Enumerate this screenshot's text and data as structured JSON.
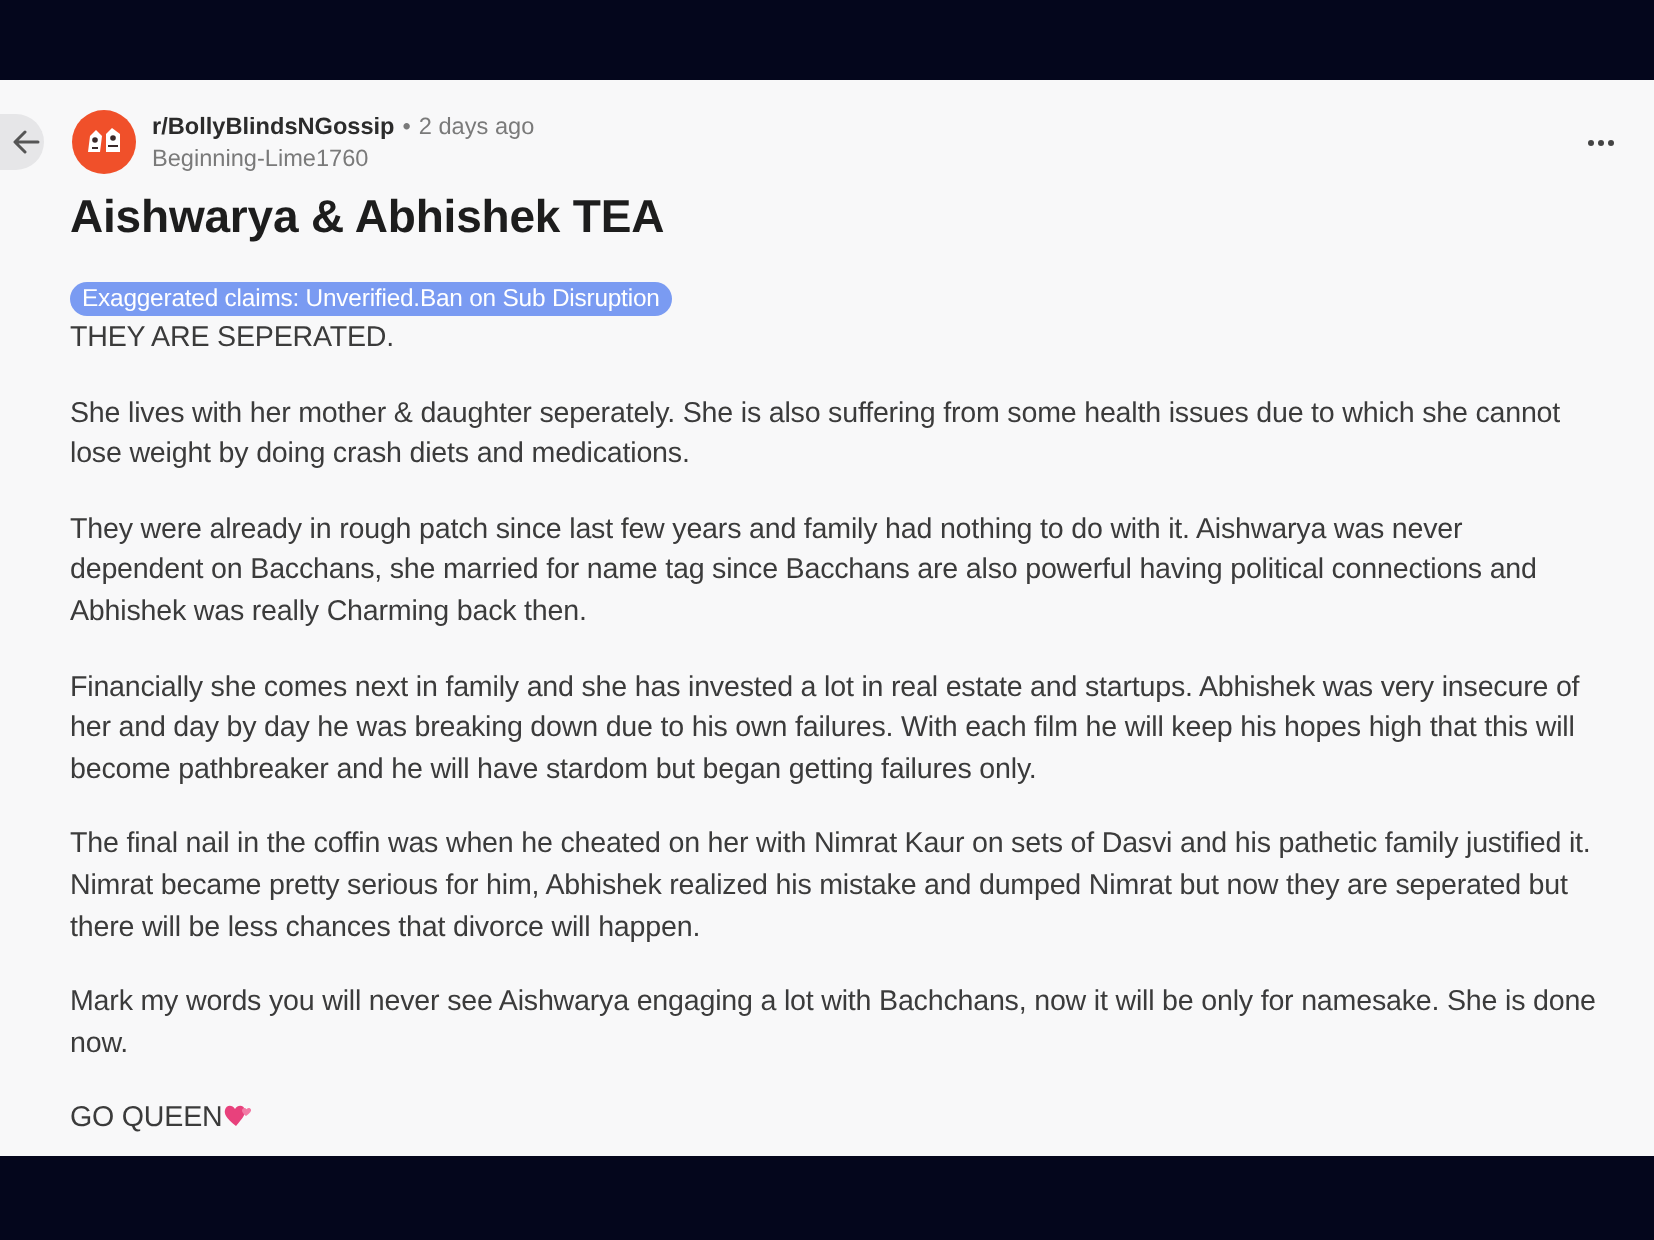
{
  "post": {
    "subreddit": "r/BollyBlindsNGossip",
    "separator": "•",
    "time": "2 days ago",
    "author": "Beginning-Lime1760",
    "title": "Aishwarya & Abhishek TEA",
    "flair": "Exaggerated claims: Unverified.Ban on Sub Disruption",
    "body": [
      {
        "text": "THEY ARE SEPERATED.",
        "trailing_emoji": false
      },
      {
        "text": "She lives with her mother & daughter seperately. She is also suffering from some health issues due to which she cannot lose weight by doing crash diets and medications.",
        "trailing_emoji": false
      },
      {
        "text": "They were already in rough patch since last few years and family had nothing to do with it. Aishwarya was never dependent on Bacchans, she married for name tag since Bacchans are also powerful having political connections and Abhishek was really Charming back then.",
        "trailing_emoji": false
      },
      {
        "text": "Financially she comes next in family and she has invested a lot in real estate and startups. Abhishek was very insecure of her and day by day he was breaking down due to his own failures. With each film he will keep his hopes high that this will become pathbreaker and he will have stardom but began getting failures only.",
        "trailing_emoji": false
      },
      {
        "text": "The final nail in the coffin was when he cheated on her with Nimrat Kaur on sets of Dasvi and his pathetic family justified it. Nimrat became pretty serious for him, Abhishek realized his mistake and dumped Nimrat but now they are seperated but there will be less chances that divorce will happen.",
        "trailing_emoji": false
      },
      {
        "text": "Mark my words you will never see Aishwarya engaging a lot with Bachchans, now it will be only for namesake. She is done now.",
        "trailing_emoji": false
      },
      {
        "text": "GO QUEEN",
        "trailing_emoji": true
      }
    ]
  }
}
